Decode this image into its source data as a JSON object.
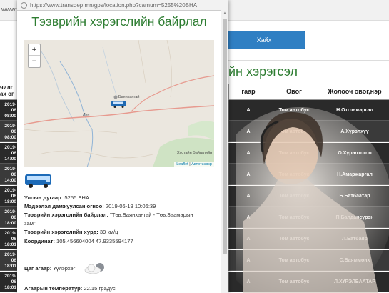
{
  "background": {
    "url_fragment": "www.tra",
    "search_button": "Хайх",
    "heading": "йн хэрэгсэл",
    "left_header": [
      "чилг",
      "ах ог"
    ],
    "columns": [
      "гаар",
      "Овог",
      "Жолооч овог,нэр"
    ],
    "rows": [
      {
        "date": "2019-06",
        "time": "08:00",
        "mark": "А",
        "type": "Том автобус",
        "driver": "Н.Отгонжаргал"
      },
      {
        "date": "2019-06",
        "time": "08:00",
        "mark": "А",
        "type": "Том автобус",
        "driver": "А.Хүрэлхүү"
      },
      {
        "date": "2019-06",
        "time": "14:00",
        "mark": "А",
        "type": "Том автобус",
        "driver": "О.Хүрэлтогоо"
      },
      {
        "date": "2019-06",
        "time": "14:00",
        "mark": "А",
        "type": "Том автобус",
        "driver": "Н.Амаржаргал"
      },
      {
        "date": "2019-06",
        "time": "18:00",
        "mark": "А",
        "type": "Том автобус",
        "driver": "Б.Батбаатар"
      },
      {
        "date": "2019-06",
        "time": "18:00",
        "mark": "А",
        "type": "Том автобус",
        "driver": "П.Балдансүрэн"
      },
      {
        "date": "2019-06",
        "time": "18:01",
        "mark": "А",
        "type": "Том автобус",
        "driver": "Л.Батбаяр"
      },
      {
        "date": "2019-06",
        "time": "18:01",
        "mark": "А",
        "type": "Том автобус",
        "driver": "С.Баяммөнх"
      },
      {
        "date": "2019-06",
        "time": "18:01",
        "mark": "А",
        "type": "Том автобус",
        "driver": "Л.ХҮРЭЛБААТАР"
      }
    ]
  },
  "popup": {
    "url": "https://www.transdep.mn/gps/location.php?carnum=5255%20БНА",
    "title": "Тээврийн хэрэгслийн байрлал",
    "map": {
      "zoom_in": "+",
      "zoom_out": "−",
      "place_1": "Баянхангай",
      "place_2": "Лүн",
      "place_3": "Хустайн Байгалийн",
      "attribution_leaflet": "Leaflet",
      "attribution_sep": " | ",
      "attribution_provider": "Автотээвэр"
    },
    "fields": [
      {
        "label": "Улсын дугаар:",
        "value": " 5255 БНА"
      },
      {
        "label": "Мэдээлэл дамжуулсан огноо:",
        "value": " 2019-06-19 10:06:39"
      },
      {
        "label": "Тээврийн хэрэгслийн байрлал:",
        "value": " \"Төв.Баянхангай - Төв.Заамарын"
      },
      {
        "label": "",
        "value": "зам\""
      },
      {
        "label": "Тээврийн хэрэгслийн хурд:",
        "value": " 39 км/ц"
      },
      {
        "label": "Координат:",
        "value": " 105.456604004 47.9335594177"
      }
    ],
    "weather_label": "Цаг агаар:",
    "weather_value": " Үүлэрхэг",
    "temperature_label": "Агаарын температур:",
    "temperature_value": " 22.15 градус"
  },
  "colors": {
    "title_green": "#2e7d32",
    "button_blue": "#2f7fc3",
    "row_dark": "#2a2a2a"
  }
}
